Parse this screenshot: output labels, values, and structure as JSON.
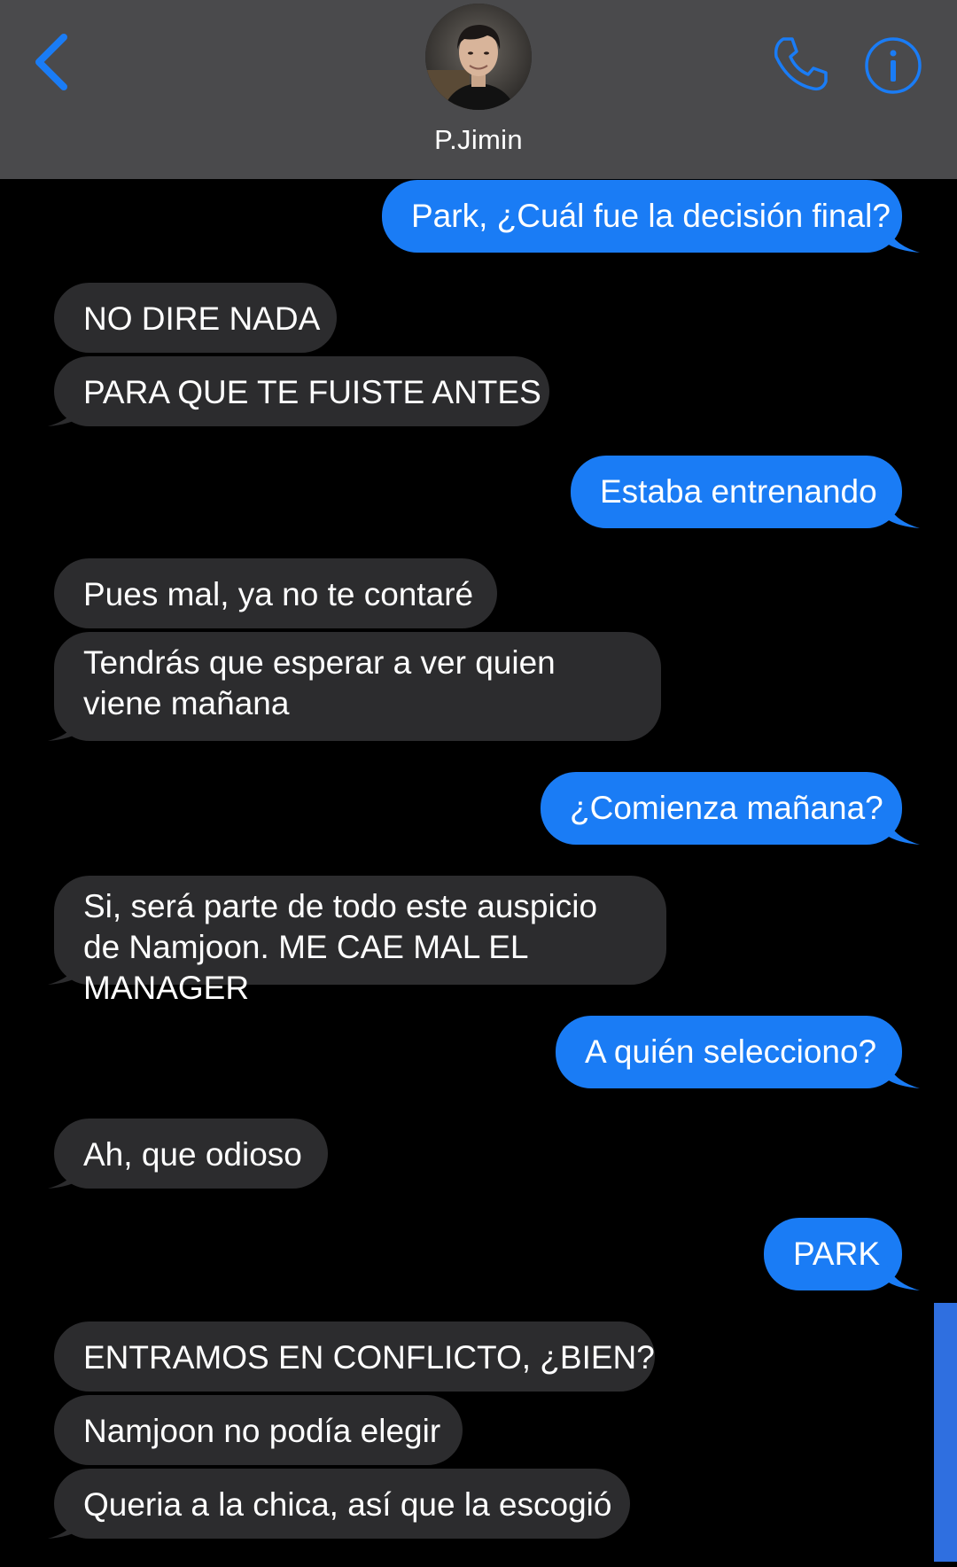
{
  "contact": {
    "name": "P.Jimin"
  },
  "colors": {
    "accent": "#1a7cf5",
    "header_bg": "#4a4a4c",
    "incoming_bubble": "#2c2c2e",
    "outgoing_bubble": "#1a7cf5",
    "background": "#000000"
  },
  "icons": {
    "back": "chevron-left-icon",
    "phone": "phone-icon",
    "info": "info-icon"
  },
  "messages": [
    {
      "dir": "out",
      "text": "Park, ¿Cuál fue la decisión final?"
    },
    {
      "dir": "in",
      "text": "NO DIRE NADA"
    },
    {
      "dir": "in",
      "text": "PARA QUE TE FUISTE ANTES"
    },
    {
      "dir": "out",
      "text": "Estaba entrenando"
    },
    {
      "dir": "in",
      "text": "Pues mal, ya no te contaré"
    },
    {
      "dir": "in",
      "text": "Tendrás que esperar a ver quien viene mañana"
    },
    {
      "dir": "out",
      "text": "¿Comienza mañana?"
    },
    {
      "dir": "in",
      "text": "Si, será parte de todo este auspicio de Namjoon. ME CAE MAL EL MANAGER"
    },
    {
      "dir": "out",
      "text": "A quién selecciono?"
    },
    {
      "dir": "in",
      "text": "Ah, que odioso"
    },
    {
      "dir": "out",
      "text": "PARK"
    },
    {
      "dir": "in",
      "text": "ENTRAMOS EN CONFLICTO, ¿BIEN?"
    },
    {
      "dir": "in",
      "text": "Namjoon no podía elegir"
    },
    {
      "dir": "in",
      "text": "Queria a la chica, así que la escogió"
    }
  ]
}
